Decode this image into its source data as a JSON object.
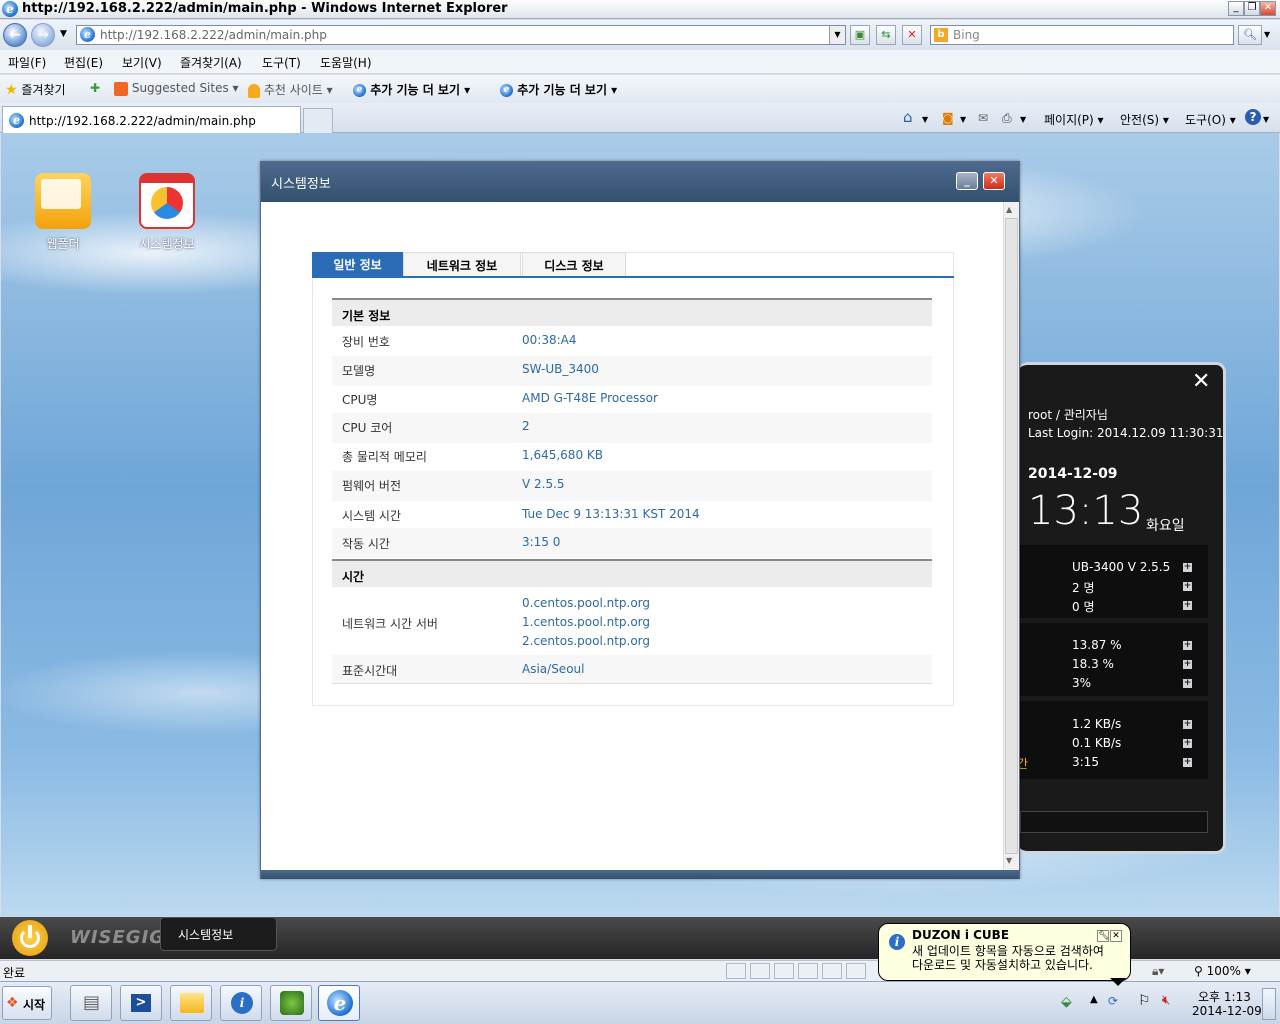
{
  "window": {
    "title": "http://192.168.2.222/admin/main.php - Windows Internet Explorer"
  },
  "address": {
    "url": "http://192.168.2.222/admin/main.php",
    "search_placeholder": "Bing"
  },
  "menu": [
    "파일(F)",
    "편집(E)",
    "보기(V)",
    "즐겨찾기(A)",
    "도구(T)",
    "도움말(H)"
  ],
  "favorites": {
    "label": "즐겨찾기",
    "items": [
      "Suggested Sites ▾",
      "추천 사이트 ▾",
      "추가 기능 더 보기 ▾",
      "추가 기능 더 보기 ▾"
    ]
  },
  "tab": {
    "title": "http://192.168.2.222/admin/main.php"
  },
  "commandbar": {
    "page": "페이지(P) ▾",
    "safety": "안전(S) ▾",
    "tools": "도구(O) ▾"
  },
  "desktop_icons": [
    {
      "label": "웹폴더"
    },
    {
      "label": "시스템정보"
    }
  ],
  "sysinfo": {
    "title": "시스템정보",
    "tabs": [
      "일반 정보",
      "네트워크 정보",
      "디스크 정보"
    ],
    "section_basic": "기본 정보",
    "rows": [
      {
        "k": "장비 번호",
        "v": "00:38:A4"
      },
      {
        "k": "모델명",
        "v": "SW-UB_3400"
      },
      {
        "k": "CPU명",
        "v": "AMD G-T48E Processor"
      },
      {
        "k": "CPU 코어",
        "v": "2"
      },
      {
        "k": "총 물리적 메모리",
        "v": "1,645,680 KB"
      },
      {
        "k": "펌웨어 버전",
        "v": "V 2.5.5"
      },
      {
        "k": "시스템 시간",
        "v": "Tue Dec 9 13:13:31 KST 2014"
      },
      {
        "k": "작동 시간",
        "v": "3:15 0"
      }
    ],
    "section_time": "시간",
    "ntp_label": "네트워크 시간 서버",
    "ntp_servers": [
      "0.centos.pool.ntp.org",
      "1.centos.pool.ntp.org",
      "2.centos.pool.ntp.org"
    ],
    "tz_label": "표준시간대",
    "tz_value": "Asia/Seoul"
  },
  "widget": {
    "user": "root / 관리자님",
    "last_login": "Last Login: 2014.12.09 11:30:31",
    "date": "2014-12-09",
    "time": "13:13",
    "weekday": "화요일",
    "group1": [
      "UB-3400 V 2.5.5",
      "2 명",
      "0 명"
    ],
    "group2": [
      "13.87 %",
      "18.3 %",
      "3%"
    ],
    "group3": [
      "1.2 KB/s",
      "0.1 KB/s",
      "3:15"
    ],
    "group3_label_fragment": "간"
  },
  "app_taskbar": {
    "logo": "WISEGIGA",
    "button": "시스템정보"
  },
  "statusbar": {
    "text": "완료",
    "zoom": "100%"
  },
  "taskbar": {
    "start": "시작",
    "clock_time": "오후 1:13",
    "clock_date": "2014-12-09"
  },
  "balloon": {
    "title": "DUZON i CUBE",
    "line1": "새 업데이트 항목을 자동으로 검색하여",
    "line2": "다운로드 및 자동설치하고 있습니다."
  }
}
